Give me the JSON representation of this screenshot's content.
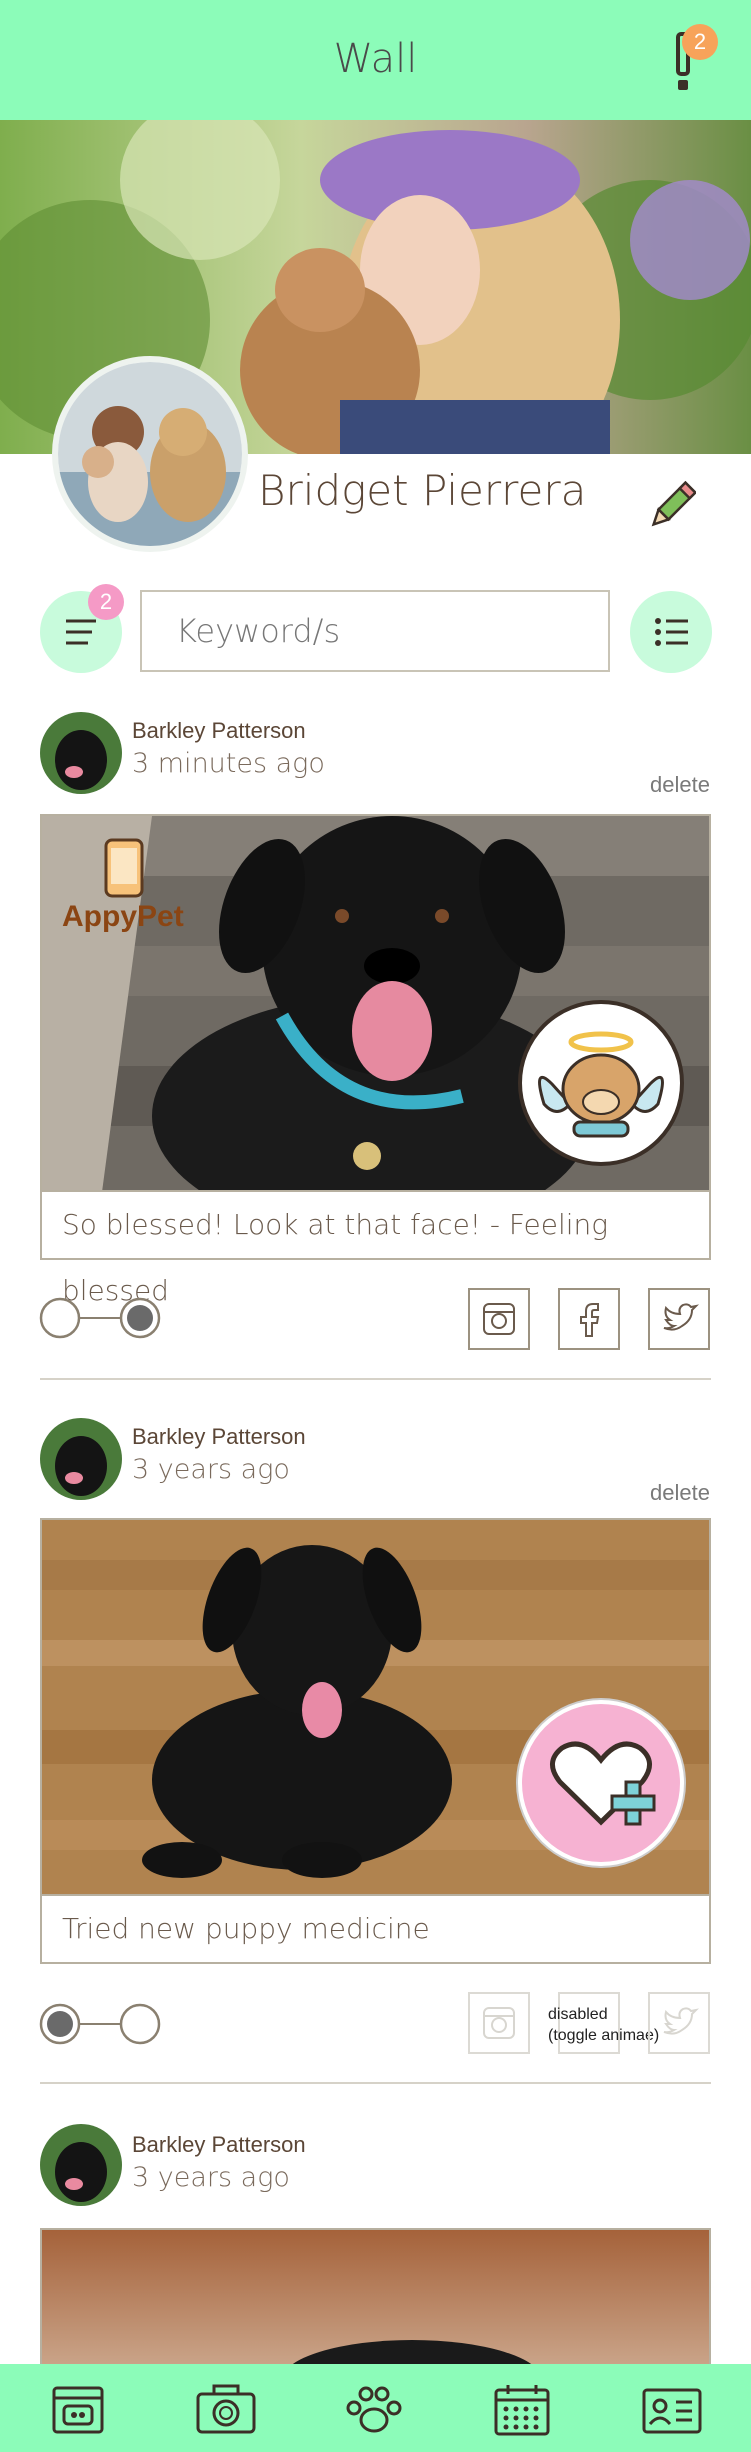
{
  "header": {
    "title": "Wall",
    "notification_count": "2"
  },
  "profile": {
    "name": "Bridget Pierrera"
  },
  "toolbar": {
    "filter_badge": "2",
    "search_placeholder": "Keyword/s"
  },
  "posts": [
    {
      "author": "Barkley Patterson",
      "time": "3 minutes ago",
      "delete_label": "delete",
      "watermark": "AppyPet",
      "caption": "So blessed! Look at that face! - Feeling blessed",
      "overlay_icon": "angel-dog-icon",
      "toggle_state": "on"
    },
    {
      "author": "Barkley Patterson",
      "time": "3 years ago",
      "delete_label": "delete",
      "caption": "Tried new puppy medicine",
      "overlay_icon": "heart-plus-icon",
      "toggle_state": "off",
      "disabled_note_line1": "disabled",
      "disabled_note_line2": "(toggle animae)"
    },
    {
      "author": "Barkley Patterson",
      "time": "3 years ago"
    }
  ],
  "bottom_nav": [
    "dog-bed-icon",
    "camera-icon",
    "paw-icon",
    "calendar-icon",
    "profile-card-icon"
  ],
  "colors": {
    "accent_green": "#8cfcb9",
    "light_green": "#c8fbdc",
    "badge_orange": "#f7a35a",
    "badge_pink": "#f59ac6",
    "text_brown": "#5b4636"
  }
}
